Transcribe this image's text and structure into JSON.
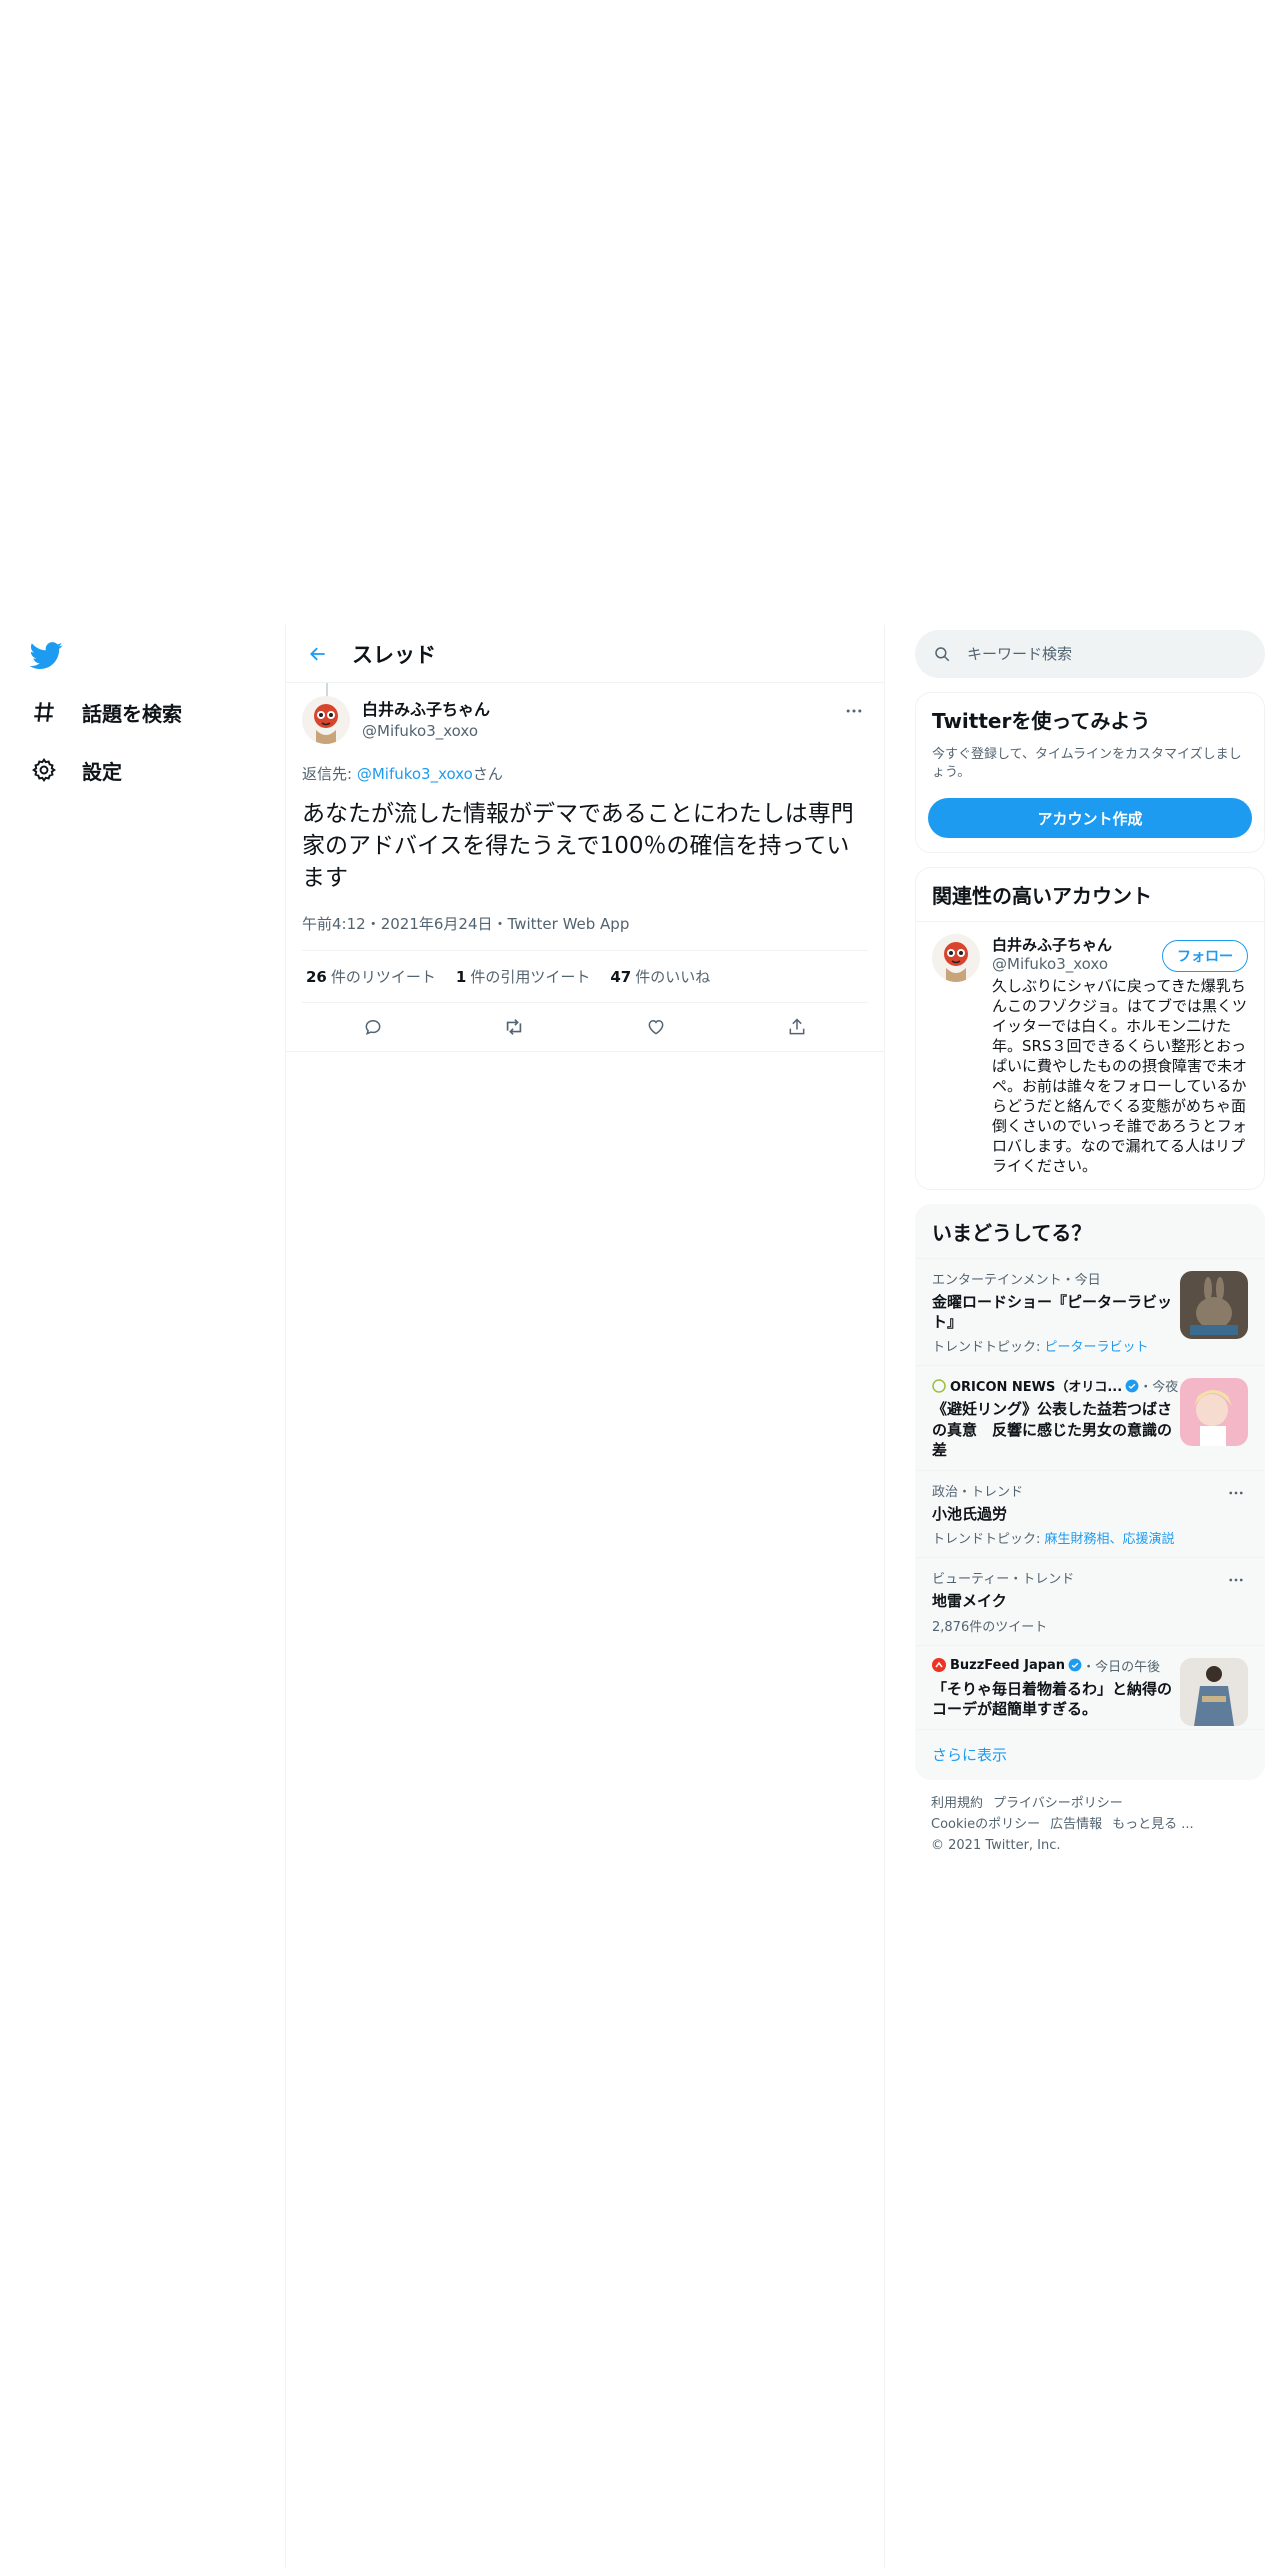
{
  "nav": {
    "items": [
      {
        "label": "話題を検索",
        "icon": "hashtag-icon"
      },
      {
        "label": "設定",
        "icon": "gear-icon"
      }
    ]
  },
  "header": {
    "title": "スレッド"
  },
  "tweet": {
    "display_name": "白井みふ子ちゃん",
    "handle": "@Mifuko3_xoxo",
    "reply_prefix": "返信先: ",
    "reply_mention": "@Mifuko3_xoxo",
    "reply_suffix": "さん",
    "text": "あなたが流した情報がデマであることにわたしは専門家のアドバイスを得たうえで100％の確信を持っています",
    "time": "午前4:12",
    "date": "2021年6月24日",
    "via": "Twitter Web App",
    "retweets_count": "26",
    "retweets_label": "件のリツイート",
    "quotes_count": "1",
    "quotes_label": "件の引用ツイート",
    "likes_count": "47",
    "likes_label": "件のいいね"
  },
  "search": {
    "placeholder": "キーワード検索"
  },
  "signup": {
    "title": "Twitterを使ってみよう",
    "subtitle": "今すぐ登録して、タイムラインをカスタマイズしましょう。",
    "button": "アカウント作成"
  },
  "related": {
    "title": "関連性の高いアカウント",
    "user": {
      "name": "白井みふ子ちゃん",
      "handle": "@Mifuko3_xoxo",
      "follow": "フォロー",
      "bio": "久しぶりにシャバに戻ってきた爆乳ちんこのフゾクジョ。はてブでは黒くツイッターでは白く。ホルモン二けた年。SRS３回できるくらい整形とおっぱいに費やしたものの摂食障害で未オペ。お前は誰々をフォローしているからどうだと絡んでくる変態がめちゃ面倒くさいのでいっそ誰であろうとフォロバします。なので漏れてる人はリプライください。"
    }
  },
  "trends": {
    "title": "いまどうしてる？",
    "items": [
      {
        "meta": "エンターテインメント・今日",
        "title": "金曜ロードショー『ピーターラビット』",
        "sub_prefix": "トレンドトピック: ",
        "sub_link": "ピーターラビット"
      },
      {
        "source": "ORICON NEWS（オリコ...",
        "meta_suffix": "・今夜",
        "title": "《避妊リング》公表した益若つばさの真意　反響に感じた男女の意識の差"
      },
      {
        "meta": "政治・トレンド",
        "title": "小池氏過労",
        "sub_prefix": "トレンドトピック: ",
        "sub_link": "麻生財務相、応援演説"
      },
      {
        "meta": "ビューティー・トレンド",
        "title": "地雷メイク",
        "sub": "2,876件のツイート"
      },
      {
        "source": "BuzzFeed Japan",
        "meta_suffix": "・今日の午後",
        "title": "「そりゃ毎日着物着るわ」と納得のコーデが超簡単すぎる。"
      }
    ],
    "show_more": "さらに表示"
  },
  "footer": {
    "terms": "利用規約",
    "privacy": "プライバシーポリシー",
    "cookie": "Cookieのポリシー",
    "ads": "広告情報",
    "more": "もっと見る ...",
    "copyright": "© 2021 Twitter, Inc."
  },
  "colors": {
    "accent": "#1d9bf0",
    "text": "#0f1419",
    "muted": "#536471",
    "border": "#eff3f4"
  }
}
